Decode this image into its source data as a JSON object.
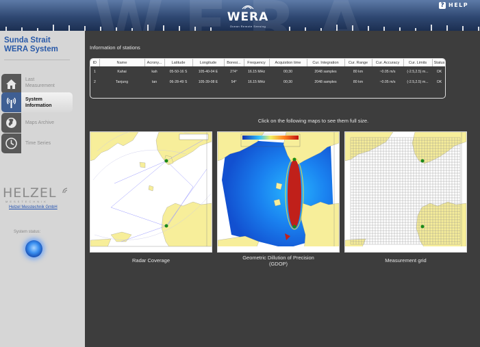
{
  "header": {
    "watermark": "WERA",
    "logo_text": "WERA",
    "logo_subtitle": "Ocean Remote Sensing",
    "help_icon": "?",
    "help_label": "HELP"
  },
  "sidebar": {
    "title_line1": "Sunda Strait",
    "title_line2": "WERA System",
    "nav": [
      {
        "label_line1": "Last",
        "label_line2": "Measurement",
        "icon": "house-icon"
      },
      {
        "label_line1": "System",
        "label_line2": "Information",
        "icon": "antenna-icon"
      },
      {
        "label_line1": "Maps Archive",
        "label_line2": "",
        "icon": "globe-icon"
      },
      {
        "label_line1": "Time Series",
        "label_line2": "",
        "icon": "clock-icon"
      }
    ],
    "brand": {
      "name": "HELZEL",
      "subtitle": "MESSTECHNIK",
      "link": "Helzel Messtechnik GmbH"
    },
    "status_label": "System status:"
  },
  "main": {
    "section_title": "Information of stations",
    "table": {
      "columns": [
        "ID",
        "Name",
        "Acrony...",
        "Latitude",
        "Longitude",
        "Boresi...",
        "Frequency",
        "Acquistion time",
        "Cur. Integration",
        "Cur. Range",
        "Cur. Accuracy",
        "Cur. Limits",
        "Status"
      ],
      "rows": [
        [
          "1",
          "Kahai",
          "kah",
          "05-50-16 S",
          "105-40-04 E",
          "274°",
          "16.15 MHz",
          "00;30",
          "2048 samples",
          "80 km",
          "~0.05 m/s",
          "(-2.5,2.5) m...",
          "OK"
        ],
        [
          "2",
          "Tanjung",
          "tan",
          "06-28-49 S",
          "105-39-08 E",
          "54°",
          "16.15 MHz",
          "00;30",
          "2048 samples",
          "80 km",
          "~0.05 m/s",
          "(-2.5,2.5) m...",
          "OK"
        ]
      ]
    },
    "maps_instruction": "Click on the following maps to see them full size.",
    "maps": [
      {
        "caption_line1": "Radar Coverage",
        "caption_line2": ""
      },
      {
        "caption_line1": "Geometric Dillution of Precision",
        "caption_line2": "(GDOP)"
      },
      {
        "caption_line1": "Measurement grid",
        "caption_line2": ""
      }
    ]
  },
  "colors": {
    "header_dark": "#1c2f52",
    "sidebar_bg": "#d6d6d6",
    "main_bg": "#3d3d3d",
    "title_blue": "#2a5aa8",
    "land_yellow": "#f7ee9a",
    "gdop_blue": "#1877ef",
    "gdop_red": "#c0201a"
  }
}
